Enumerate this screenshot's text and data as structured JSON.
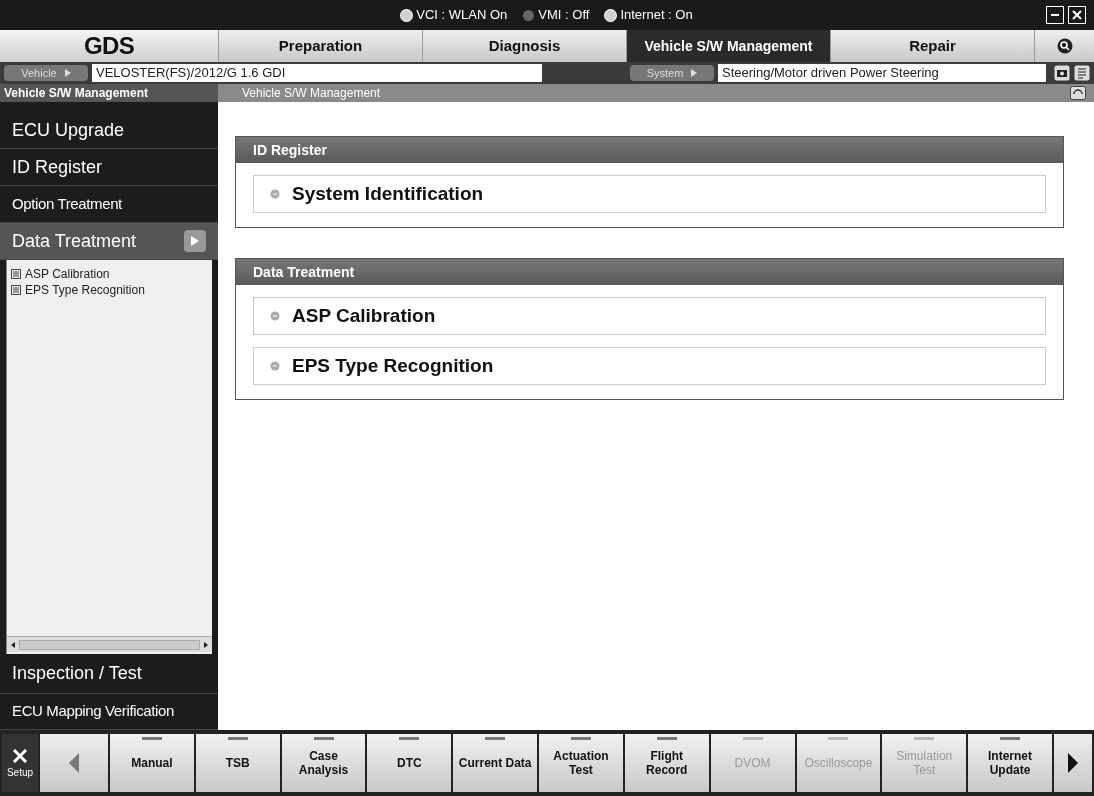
{
  "status_bar": [
    {
      "label": "VCI : WLAN On",
      "on": true
    },
    {
      "label": "VMI : Off",
      "on": false
    },
    {
      "label": "Internet : On",
      "on": true
    }
  ],
  "logo": "GDS",
  "tabs": [
    {
      "label": "Preparation",
      "selected": false
    },
    {
      "label": "Diagnosis",
      "selected": false
    },
    {
      "label": "Vehicle S/W Management",
      "selected": true
    },
    {
      "label": "Repair",
      "selected": false
    }
  ],
  "vehicle_bar": {
    "vehicle_label": "Vehicle",
    "vehicle": "VELOSTER(FS)/2012/G 1.6 GDI",
    "system_label": "System",
    "system": "Steering/Motor driven Power Steering"
  },
  "sidebar": {
    "title": "Vehicle S/W Management",
    "items": [
      {
        "label": "ECU Upgrade",
        "kind": "large",
        "selected": false
      },
      {
        "label": "ID Register",
        "kind": "large",
        "selected": false
      },
      {
        "label": "Option Treatment",
        "kind": "small",
        "selected": false
      },
      {
        "label": "Data Treatment",
        "kind": "large",
        "selected": true
      }
    ],
    "sub_items": [
      "ASP Calibration",
      "EPS Type Recognition"
    ],
    "bottom_items": [
      {
        "label": "Inspection / Test",
        "kind": "large"
      },
      {
        "label": "ECU Mapping Verification",
        "kind": "small"
      }
    ]
  },
  "main": {
    "title": "Vehicle S/W Management",
    "sections": [
      {
        "title": "ID Register",
        "items": [
          "System Identification"
        ]
      },
      {
        "title": "Data Treatment",
        "items": [
          "ASP Calibration",
          "EPS Type Recognition"
        ]
      }
    ]
  },
  "toolbar": {
    "setup": "Setup",
    "items": [
      {
        "label": "Manual",
        "disabled": false
      },
      {
        "label": "TSB",
        "disabled": false
      },
      {
        "label": "Case Analysis",
        "disabled": false
      },
      {
        "label": "DTC",
        "disabled": false
      },
      {
        "label": "Current Data",
        "disabled": false
      },
      {
        "label": "Actuation Test",
        "disabled": false
      },
      {
        "label": "Flight Record",
        "disabled": false
      },
      {
        "label": "DVOM",
        "disabled": true
      },
      {
        "label": "Oscilloscope",
        "disabled": true
      },
      {
        "label": "Simulation Test",
        "disabled": true
      },
      {
        "label": "Internet Update",
        "disabled": false
      }
    ]
  }
}
